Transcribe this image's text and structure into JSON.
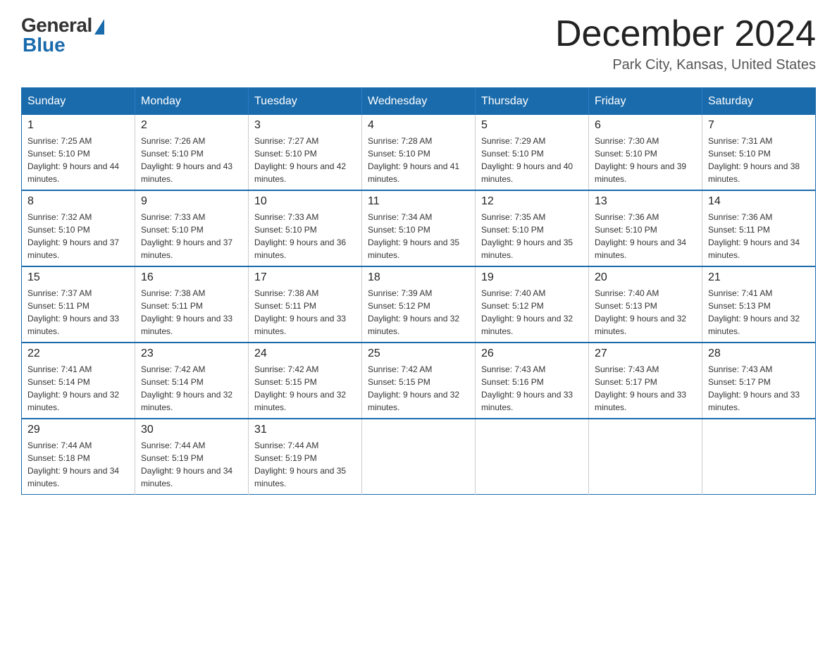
{
  "logo": {
    "general": "General",
    "blue": "Blue"
  },
  "title": "December 2024",
  "location": "Park City, Kansas, United States",
  "days_of_week": [
    "Sunday",
    "Monday",
    "Tuesday",
    "Wednesday",
    "Thursday",
    "Friday",
    "Saturday"
  ],
  "weeks": [
    [
      {
        "day": "1",
        "sunrise": "7:25 AM",
        "sunset": "5:10 PM",
        "daylight": "9 hours and 44 minutes."
      },
      {
        "day": "2",
        "sunrise": "7:26 AM",
        "sunset": "5:10 PM",
        "daylight": "9 hours and 43 minutes."
      },
      {
        "day": "3",
        "sunrise": "7:27 AM",
        "sunset": "5:10 PM",
        "daylight": "9 hours and 42 minutes."
      },
      {
        "day": "4",
        "sunrise": "7:28 AM",
        "sunset": "5:10 PM",
        "daylight": "9 hours and 41 minutes."
      },
      {
        "day": "5",
        "sunrise": "7:29 AM",
        "sunset": "5:10 PM",
        "daylight": "9 hours and 40 minutes."
      },
      {
        "day": "6",
        "sunrise": "7:30 AM",
        "sunset": "5:10 PM",
        "daylight": "9 hours and 39 minutes."
      },
      {
        "day": "7",
        "sunrise": "7:31 AM",
        "sunset": "5:10 PM",
        "daylight": "9 hours and 38 minutes."
      }
    ],
    [
      {
        "day": "8",
        "sunrise": "7:32 AM",
        "sunset": "5:10 PM",
        "daylight": "9 hours and 37 minutes."
      },
      {
        "day": "9",
        "sunrise": "7:33 AM",
        "sunset": "5:10 PM",
        "daylight": "9 hours and 37 minutes."
      },
      {
        "day": "10",
        "sunrise": "7:33 AM",
        "sunset": "5:10 PM",
        "daylight": "9 hours and 36 minutes."
      },
      {
        "day": "11",
        "sunrise": "7:34 AM",
        "sunset": "5:10 PM",
        "daylight": "9 hours and 35 minutes."
      },
      {
        "day": "12",
        "sunrise": "7:35 AM",
        "sunset": "5:10 PM",
        "daylight": "9 hours and 35 minutes."
      },
      {
        "day": "13",
        "sunrise": "7:36 AM",
        "sunset": "5:10 PM",
        "daylight": "9 hours and 34 minutes."
      },
      {
        "day": "14",
        "sunrise": "7:36 AM",
        "sunset": "5:11 PM",
        "daylight": "9 hours and 34 minutes."
      }
    ],
    [
      {
        "day": "15",
        "sunrise": "7:37 AM",
        "sunset": "5:11 PM",
        "daylight": "9 hours and 33 minutes."
      },
      {
        "day": "16",
        "sunrise": "7:38 AM",
        "sunset": "5:11 PM",
        "daylight": "9 hours and 33 minutes."
      },
      {
        "day": "17",
        "sunrise": "7:38 AM",
        "sunset": "5:11 PM",
        "daylight": "9 hours and 33 minutes."
      },
      {
        "day": "18",
        "sunrise": "7:39 AM",
        "sunset": "5:12 PM",
        "daylight": "9 hours and 32 minutes."
      },
      {
        "day": "19",
        "sunrise": "7:40 AM",
        "sunset": "5:12 PM",
        "daylight": "9 hours and 32 minutes."
      },
      {
        "day": "20",
        "sunrise": "7:40 AM",
        "sunset": "5:13 PM",
        "daylight": "9 hours and 32 minutes."
      },
      {
        "day": "21",
        "sunrise": "7:41 AM",
        "sunset": "5:13 PM",
        "daylight": "9 hours and 32 minutes."
      }
    ],
    [
      {
        "day": "22",
        "sunrise": "7:41 AM",
        "sunset": "5:14 PM",
        "daylight": "9 hours and 32 minutes."
      },
      {
        "day": "23",
        "sunrise": "7:42 AM",
        "sunset": "5:14 PM",
        "daylight": "9 hours and 32 minutes."
      },
      {
        "day": "24",
        "sunrise": "7:42 AM",
        "sunset": "5:15 PM",
        "daylight": "9 hours and 32 minutes."
      },
      {
        "day": "25",
        "sunrise": "7:42 AM",
        "sunset": "5:15 PM",
        "daylight": "9 hours and 32 minutes."
      },
      {
        "day": "26",
        "sunrise": "7:43 AM",
        "sunset": "5:16 PM",
        "daylight": "9 hours and 33 minutes."
      },
      {
        "day": "27",
        "sunrise": "7:43 AM",
        "sunset": "5:17 PM",
        "daylight": "9 hours and 33 minutes."
      },
      {
        "day": "28",
        "sunrise": "7:43 AM",
        "sunset": "5:17 PM",
        "daylight": "9 hours and 33 minutes."
      }
    ],
    [
      {
        "day": "29",
        "sunrise": "7:44 AM",
        "sunset": "5:18 PM",
        "daylight": "9 hours and 34 minutes."
      },
      {
        "day": "30",
        "sunrise": "7:44 AM",
        "sunset": "5:19 PM",
        "daylight": "9 hours and 34 minutes."
      },
      {
        "day": "31",
        "sunrise": "7:44 AM",
        "sunset": "5:19 PM",
        "daylight": "9 hours and 35 minutes."
      },
      null,
      null,
      null,
      null
    ]
  ]
}
